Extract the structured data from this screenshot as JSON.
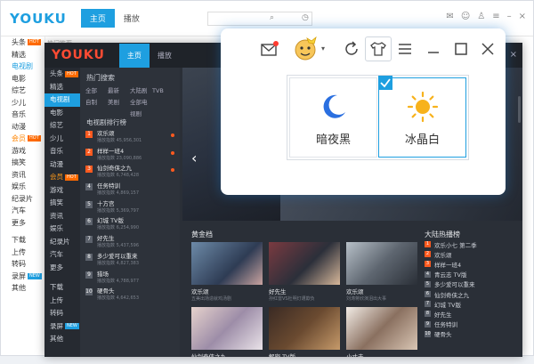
{
  "back_window": {
    "logo": "YOUKU",
    "tab_home": "主页",
    "tab_live": "播放",
    "strip": "热门推荐",
    "sidebar": [
      {
        "label": "头条",
        "badge": "HOT"
      },
      {
        "label": "精选"
      },
      {
        "label": "电视剧",
        "active": true
      },
      {
        "label": "电影"
      },
      {
        "label": "综艺"
      },
      {
        "label": "少儿"
      },
      {
        "label": "音乐"
      },
      {
        "label": "动漫"
      },
      {
        "label": "会员",
        "badge": "HOT",
        "vip": true
      },
      {
        "label": "游戏"
      },
      {
        "label": "搞笑"
      },
      {
        "label": "资讯"
      },
      {
        "label": "娱乐"
      },
      {
        "label": "纪录片"
      },
      {
        "label": "汽车"
      },
      {
        "label": "更多"
      },
      {
        "label": "下载",
        "sep": true
      },
      {
        "label": "上传"
      },
      {
        "label": "转码"
      },
      {
        "label": "录屏",
        "badge": "NEW"
      },
      {
        "label": "其他"
      }
    ]
  },
  "main_window": {
    "logo": "YOUKU",
    "tab_home": "主页",
    "tab_live": "播放",
    "close": "×",
    "sidebar": [
      {
        "label": "头条",
        "badge": "HOT"
      },
      {
        "label": "精选"
      },
      {
        "label": "电视剧",
        "active": true
      },
      {
        "label": "电影"
      },
      {
        "label": "综艺"
      },
      {
        "label": "少儿"
      },
      {
        "label": "音乐"
      },
      {
        "label": "动漫"
      },
      {
        "label": "会员",
        "badge": "HOT",
        "vip": true
      },
      {
        "label": "游戏"
      },
      {
        "label": "搞笑"
      },
      {
        "label": "资讯"
      },
      {
        "label": "娱乐"
      },
      {
        "label": "纪录片"
      },
      {
        "label": "汽车"
      },
      {
        "label": "更多"
      },
      {
        "label": "下载",
        "sep": true
      },
      {
        "label": "上传"
      },
      {
        "label": "转码"
      },
      {
        "label": "录屏",
        "badge": "NEW"
      },
      {
        "label": "其他"
      }
    ],
    "hot_title": "热门搜索",
    "hot_tags": [
      "全部",
      "最新",
      "大陆剧",
      "TVB",
      "自制",
      "美剧",
      "全部电视剧"
    ],
    "ranking_title": "电视剧排行榜",
    "ranking": [
      {
        "n": "1",
        "title": "欢乐颂",
        "sub": "播放指数 45,956,301",
        "hot": true
      },
      {
        "n": "2",
        "title": "样样一班4",
        "sub": "播放指数 23,090,886",
        "hot": true
      },
      {
        "n": "3",
        "title": "仙剑奇侠之九",
        "sub": "播放指数 6,748,428",
        "hot": true
      },
      {
        "n": "4",
        "title": "任务特训",
        "sub": "播放指数 4,869,157"
      },
      {
        "n": "5",
        "title": "十方宫",
        "sub": "播放指数 5,369,797"
      },
      {
        "n": "6",
        "title": "幻城 TV版",
        "sub": "播放指数 6,254,990"
      },
      {
        "n": "7",
        "title": "好先生",
        "sub": "播放指数 5,437,596"
      },
      {
        "n": "8",
        "title": "多少爱可以重来",
        "sub": "播放指数 4,827,383"
      },
      {
        "n": "9",
        "title": "猎场",
        "sub": "播放指数 4,788,977"
      },
      {
        "n": "10",
        "title": "硬骨头",
        "sub": "播放指数 4,642,653"
      }
    ],
    "golden_title": "黄金档",
    "thumbs": [
      {
        "title": "欢乐颂",
        "sub": "五美出场造就鸡汤剧"
      },
      {
        "title": "好先生",
        "sub": "孙红雷VS杜明灯遭欺负"
      },
      {
        "title": "欢乐颂",
        "sub": "刘涛蒋欣演泪出大事"
      },
      {
        "title": "仙剑奇侠之九",
        "sub": "仙剑五当你"
      },
      {
        "title": "解密 TV版",
        "sub": "天才密码破解"
      },
      {
        "title": "小丈夫",
        "sub": "成熟男人的婚姻观"
      }
    ],
    "mainland_title": "大陆热播榜",
    "mainland": [
      "欢乐小七 第二季",
      "欢乐颂",
      "样样一班4",
      "青云志 TV版",
      "多少爱可以重来",
      "仙剑奇侠之九",
      "幻城 TV版",
      "好先生",
      "任务特训",
      "硬骨头"
    ]
  },
  "popup": {
    "icons": [
      "mail-icon",
      "avatar-icon",
      "refresh-icon",
      "shirt-icon",
      "menu-icon",
      "minimize-icon",
      "maximize-icon",
      "close-icon"
    ],
    "skins": [
      {
        "name": "暗夜黑",
        "icon": "moon-icon",
        "selected": false
      },
      {
        "name": "冰晶白",
        "icon": "sun-icon",
        "selected": true
      }
    ],
    "accent": "#1e9fe0"
  }
}
